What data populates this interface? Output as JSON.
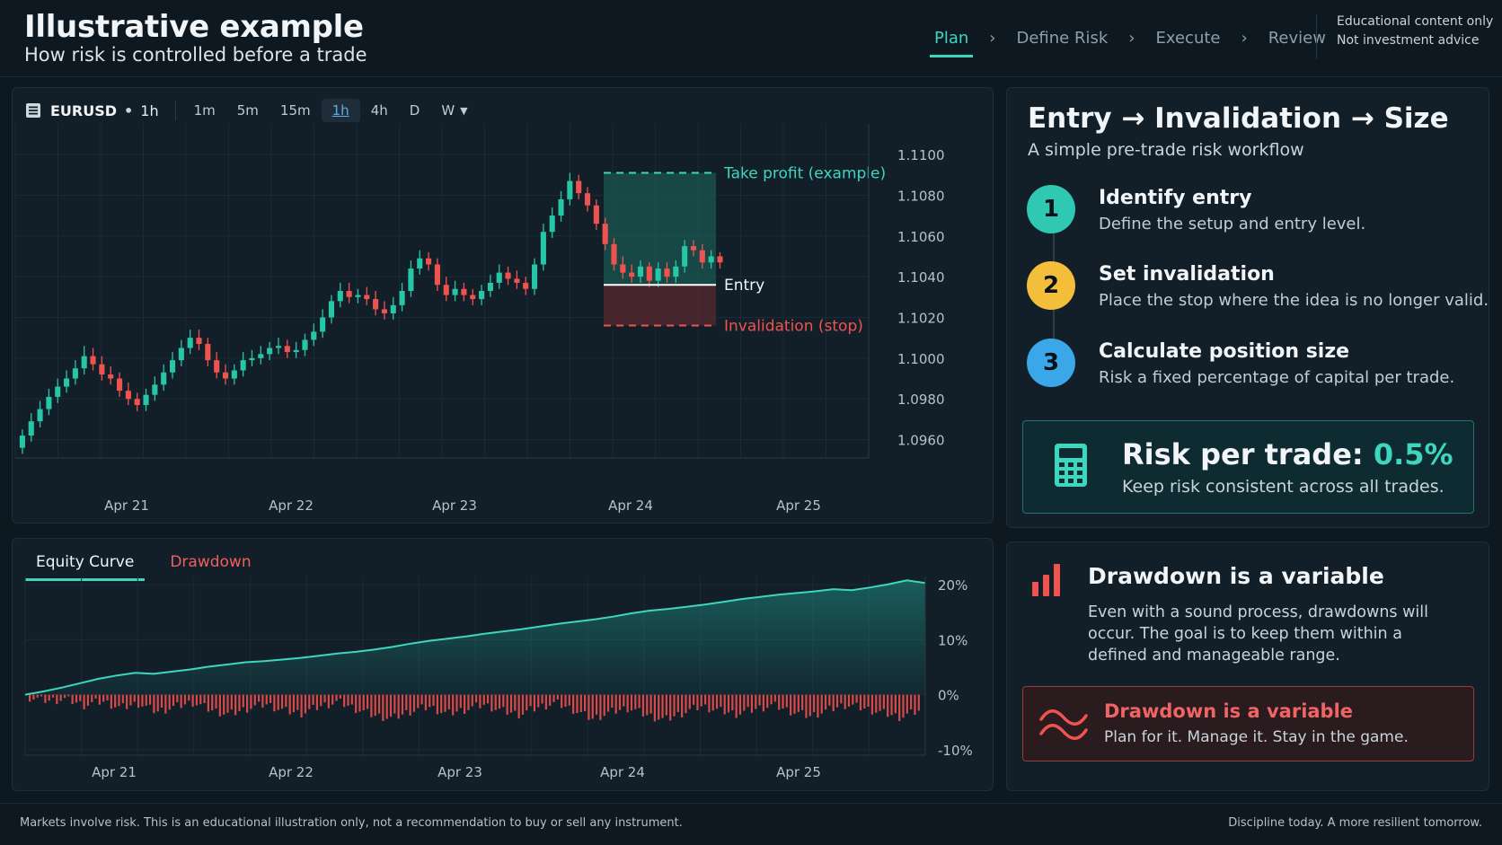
{
  "header": {
    "title": "Illustrative example",
    "subtitle": "How risk is controlled before a trade",
    "steps": [
      "Plan",
      "Define Risk",
      "Execute",
      "Review"
    ],
    "active_step": "Plan",
    "disclaimer": [
      "Educational content only",
      "Not investment advice"
    ]
  },
  "chart": {
    "symbol": "EURUSD",
    "timeframe": "1h",
    "timeframes": [
      "1m",
      "5m",
      "15m",
      "1h",
      "4h",
      "D",
      "W"
    ],
    "active_timeframe": "1h",
    "annotations": {
      "take_profit": "Take profit (example)",
      "entry": "Entry",
      "stop": "Invalidation (stop)"
    }
  },
  "chart_data": [
    {
      "type": "candlestick",
      "x_labels": [
        "Apr 21",
        "Apr 22",
        "Apr 23",
        "Apr 24",
        "Apr 25"
      ],
      "y_ticks": [
        "1.1100",
        "1.1080",
        "1.1060",
        "1.1040",
        "1.1020",
        "1.1000",
        "1.0980",
        "1.0960"
      ],
      "ylim": [
        1.0951,
        1.1115
      ],
      "levels": {
        "take_profit": 1.1091,
        "entry": 1.1036,
        "stop": 1.1016
      },
      "close": [
        1.0962,
        1.0969,
        1.0975,
        1.0981,
        1.0986,
        1.099,
        1.0995,
        1.1001,
        1.0997,
        1.0992,
        1.099,
        1.0984,
        1.098,
        1.0977,
        1.0982,
        1.0987,
        1.0993,
        1.0999,
        1.1005,
        1.101,
        1.1007,
        1.0999,
        1.0993,
        1.099,
        1.0994,
        1.0999,
        1.1,
        1.1002,
        1.1005,
        1.1006,
        1.1003,
        1.1004,
        1.1009,
        1.1013,
        1.102,
        1.1028,
        1.1033,
        1.103,
        1.1031,
        1.1029,
        1.1024,
        1.1022,
        1.1026,
        1.1033,
        1.1044,
        1.1049,
        1.1046,
        1.1036,
        1.1031,
        1.1034,
        1.1031,
        1.1029,
        1.1033,
        1.1037,
        1.1042,
        1.1039,
        1.1037,
        1.1034,
        1.1046,
        1.1062,
        1.107,
        1.1078,
        1.1087,
        1.1081,
        1.1075,
        1.1066,
        1.1056,
        1.1046,
        1.1042,
        1.104,
        1.1045,
        1.1038,
        1.1044,
        1.104,
        1.1045,
        1.1055,
        1.1053,
        1.1047,
        1.105,
        1.1047
      ],
      "open": [
        1.0956,
        1.0962,
        1.0969,
        1.0975,
        1.0981,
        1.0986,
        1.099,
        1.0995,
        1.1001,
        1.0997,
        1.0992,
        1.099,
        1.0984,
        1.098,
        1.0977,
        1.0982,
        1.0987,
        1.0993,
        1.0999,
        1.1005,
        1.101,
        1.1007,
        1.0999,
        1.0993,
        1.099,
        1.0994,
        1.0999,
        1.1,
        1.1002,
        1.1005,
        1.1006,
        1.1003,
        1.1004,
        1.1009,
        1.1013,
        1.102,
        1.1028,
        1.1033,
        1.103,
        1.1031,
        1.1029,
        1.1024,
        1.1022,
        1.1026,
        1.1033,
        1.1044,
        1.1049,
        1.1046,
        1.1036,
        1.1031,
        1.1034,
        1.1031,
        1.1029,
        1.1033,
        1.1037,
        1.1042,
        1.1039,
        1.1037,
        1.1034,
        1.1046,
        1.1062,
        1.107,
        1.1078,
        1.1087,
        1.1081,
        1.1075,
        1.1066,
        1.1056,
        1.1046,
        1.1042,
        1.104,
        1.1045,
        1.1038,
        1.1044,
        1.104,
        1.1045,
        1.1055,
        1.1053,
        1.1047,
        1.105
      ],
      "high": [
        1.0965,
        1.0973,
        1.0979,
        1.0985,
        1.099,
        1.0994,
        1.0999,
        1.1006,
        1.1005,
        1.1001,
        1.0996,
        1.0993,
        1.0988,
        1.0983,
        1.0985,
        1.0991,
        1.0997,
        1.1003,
        1.1009,
        1.1014,
        1.1014,
        1.101,
        1.1003,
        1.0997,
        1.0997,
        1.1003,
        1.1004,
        1.1006,
        1.1008,
        1.101,
        1.1009,
        1.1008,
        1.1012,
        1.1017,
        1.1024,
        1.1031,
        1.1037,
        1.1037,
        1.1034,
        1.1035,
        1.1033,
        1.1028,
        1.103,
        1.1037,
        1.1048,
        1.1053,
        1.1052,
        1.1049,
        1.104,
        1.1038,
        1.1037,
        1.1034,
        1.1036,
        1.1041,
        1.1046,
        1.1045,
        1.1043,
        1.104,
        1.1049,
        1.1066,
        1.1074,
        1.1082,
        1.1091,
        1.109,
        1.1084,
        1.1078,
        1.1069,
        1.1059,
        1.105,
        1.1046,
        1.1048,
        1.1047,
        1.1047,
        1.1047,
        1.1048,
        1.1058,
        1.1058,
        1.1056,
        1.1053,
        1.1052
      ],
      "low": [
        1.0953,
        1.0959,
        1.0966,
        1.0972,
        1.0978,
        1.0983,
        1.0987,
        1.0992,
        1.0994,
        1.0989,
        1.0987,
        1.0981,
        1.0977,
        1.0974,
        1.0974,
        1.0979,
        1.0984,
        1.099,
        1.0996,
        1.1002,
        1.1004,
        1.0996,
        1.099,
        1.0987,
        1.0987,
        1.0991,
        1.0996,
        1.0997,
        1.0999,
        1.1002,
        1.1,
        1.1,
        1.1001,
        1.1006,
        1.101,
        1.1017,
        1.1025,
        1.1027,
        1.1027,
        1.1026,
        1.1021,
        1.1019,
        1.1019,
        1.1023,
        1.103,
        1.1041,
        1.1043,
        1.1033,
        1.1028,
        1.1028,
        1.1028,
        1.1026,
        1.1026,
        1.103,
        1.1034,
        1.1036,
        1.1034,
        1.1031,
        1.1031,
        1.1043,
        1.1059,
        1.1067,
        1.1075,
        1.1078,
        1.1072,
        1.1063,
        1.1053,
        1.1043,
        1.1039,
        1.1037,
        1.1037,
        1.1035,
        1.1035,
        1.1037,
        1.1037,
        1.1042,
        1.105,
        1.1044,
        1.1044,
        1.1044
      ]
    },
    {
      "type": "area",
      "x_labels": [
        "Apr 21",
        "Apr 22",
        "Apr 23",
        "Apr 24",
        "Apr 25"
      ],
      "y_ticks": [
        "20%",
        "10%",
        "0%",
        "-10%"
      ],
      "ylim": [
        -11,
        21.5
      ],
      "equity": [
        0.0,
        0.6,
        1.3,
        2.1,
        2.9,
        3.5,
        4.0,
        3.8,
        4.2,
        4.6,
        5.1,
        5.5,
        5.9,
        6.1,
        6.4,
        6.7,
        7.1,
        7.5,
        7.8,
        8.2,
        8.7,
        9.3,
        9.8,
        10.2,
        10.6,
        11.1,
        11.5,
        11.9,
        12.4,
        12.9,
        13.3,
        13.7,
        14.2,
        14.8,
        15.3,
        15.6,
        16.0,
        16.4,
        16.9,
        17.4,
        17.8,
        18.2,
        18.5,
        18.8,
        19.2,
        19.0,
        19.5,
        20.1,
        20.8,
        20.3
      ],
      "drawdown": [
        -0.5,
        -1.1,
        -0.8,
        -1.9,
        -1.2,
        -2.4,
        -1.6,
        -3.1,
        -2.2,
        -1.4,
        -2.8,
        -3.6,
        -2.5,
        -1.7,
        -2.9,
        -3.4,
        -2.1,
        -1.3,
        -2.6,
        -3.8,
        -4.3,
        -3.0,
        -2.2,
        -3.5,
        -2.7,
        -1.8,
        -2.9,
        -3.6,
        -2.3,
        -1.5,
        -2.8,
        -4.4,
        -3.2,
        -2.4,
        -3.7,
        -4.6,
        -3.3,
        -2.1,
        -2.9,
        -3.5,
        -2.6,
        -1.9,
        -3.1,
        -3.9,
        -2.8,
        -1.8,
        -2.5,
        -3.3,
        -4.1,
        -2.9
      ]
    }
  ],
  "equity_tabs": [
    "Equity Curve",
    "Drawdown"
  ],
  "workflow": {
    "title": "Entry → Invalidation → Size",
    "subtitle": "A simple pre-trade risk workflow",
    "steps": [
      {
        "num": "1",
        "title": "Identify entry",
        "desc": "Define the setup and entry level.",
        "color": "#2fc8b2"
      },
      {
        "num": "2",
        "title": "Set invalidation",
        "desc": "Place the stop where the idea is no longer valid.",
        "color": "#f3bf3a"
      },
      {
        "num": "3",
        "title": "Calculate position size",
        "desc": "Risk a fixed percentage of capital per trade.",
        "color": "#3aa8e8"
      }
    ],
    "risk_label": "Risk per trade:",
    "risk_value": "0.5%",
    "risk_desc": "Keep risk consistent across all trades."
  },
  "drawdown_note": {
    "title": "Drawdown is a variable",
    "text": "Even with a sound process, drawdowns will occur. The goal is to keep them within a defined and manageable range.",
    "box_title": "Drawdown is a variable",
    "box_desc": "Plan for it. Manage it. Stay in the game."
  },
  "footer": {
    "left": "Markets involve risk. This is an educational illustration only, not a recommendation to buy or sell any instrument.",
    "right": "Discipline today. A more resilient tomorrow."
  },
  "colors": {
    "accent": "#3dd6bf",
    "up": "#26c6a6",
    "down": "#ef5350",
    "warn": "#f3bf3a",
    "info": "#3aa8e8"
  }
}
